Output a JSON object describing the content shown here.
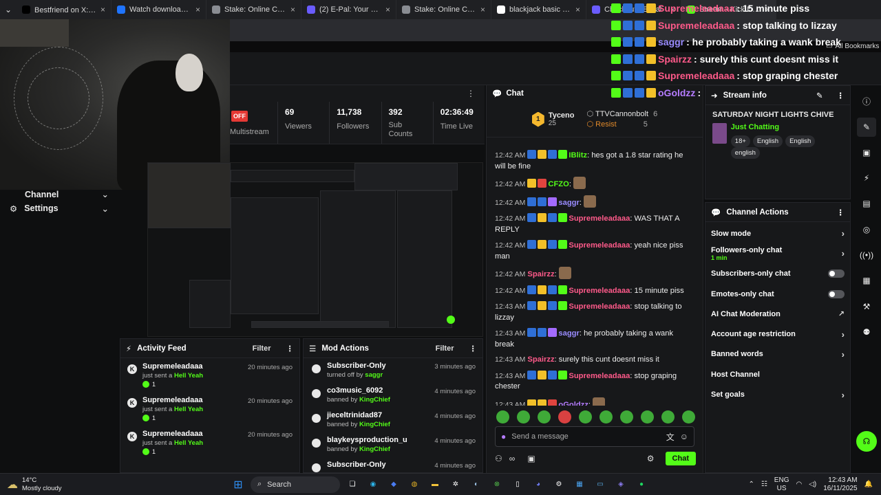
{
  "browser": {
    "tabs": [
      {
        "label": "Bestfriend on X: \"🎀Kick",
        "fav": "x-icon",
        "color": "#000000"
      },
      {
        "label": "Watch download (2) | Str",
        "fav": "globe-icon",
        "color": "#1f74ff"
      },
      {
        "label": "Stake: Online Casino &",
        "fav": "stake-icon",
        "color": "#8a8d93"
      },
      {
        "label": "(2) E-Pal: Your Kind Teamm",
        "fav": "epal-icon",
        "color": "#6a5cff"
      },
      {
        "label": "Stake: Online Casino & Sp",
        "fav": "stake-icon",
        "color": "#8a8d93"
      },
      {
        "label": "blackjack basic strategy -",
        "fav": "google-icon",
        "color": "#ffffff"
      },
      {
        "label": "Checkout - E-Pal",
        "fav": "epal-icon",
        "color": "#6a5cff"
      },
      {
        "label": "Stream - Kick Dashboard",
        "fav": "kick-icon",
        "color": "#53fc18"
      }
    ],
    "all_bookmarks": "All Bookmarks"
  },
  "overlay_chat": [
    {
      "user": "Supremeleadaaa",
      "text": ": 15 minute piss",
      "color": "#ff5a8a"
    },
    {
      "user": "Supremeleadaaa",
      "text": ": stop talking to lizzay",
      "color": "#ff5a8a"
    },
    {
      "user": "saggr",
      "text": ": he probably taking a wank break",
      "color": "#9a8cff"
    },
    {
      "user": "Spairzz",
      "text": ": surely this cunt doesnt miss it",
      "color": "#ff5a8a"
    },
    {
      "user": "Supremeleadaaa",
      "text": ": stop graping chester",
      "color": "#ff5a8a"
    },
    {
      "user": "oGoldzz",
      "text": ":",
      "color": "#b57cff"
    }
  ],
  "sidebar": {
    "channel": "Channel",
    "settings": "Settings"
  },
  "stream": {
    "off_label": "OFF",
    "multistream": "Multistream",
    "stats": [
      {
        "value": "69",
        "label": "Viewers"
      },
      {
        "value": "11,738",
        "label": "Followers"
      },
      {
        "value": "392",
        "label": "Sub Counts"
      },
      {
        "value": "02:36:49",
        "label": "Time Live"
      }
    ]
  },
  "activity_feed": {
    "title": "Activity Feed",
    "filter": "Filter",
    "items": [
      {
        "user": "Supremeleadaaa",
        "action": "just sent a",
        "item": "Hell Yeah",
        "count": "1",
        "time": "20 minutes ago"
      },
      {
        "user": "Supremeleadaaa",
        "action": "just sent a",
        "item": "Hell Yeah",
        "count": "1",
        "time": "20 minutes ago"
      },
      {
        "user": "Supremeleadaaa",
        "action": "just sent a",
        "item": "Hell Yeah",
        "count": "1",
        "time": "20 minutes ago"
      }
    ]
  },
  "mod_actions": {
    "title": "Mod Actions",
    "filter": "Filter",
    "items": [
      {
        "name": "Subscriber-Only",
        "action": "turned off by",
        "by": "saggr",
        "time": "3 minutes ago"
      },
      {
        "name": "co3music_6092",
        "action": "banned by",
        "by": "KingChief",
        "time": "4 minutes ago"
      },
      {
        "name": "jieceltrinidad87",
        "action": "banned by",
        "by": "KingChief",
        "time": "4 minutes ago"
      },
      {
        "name": "blaykeysproduction_u",
        "action": "banned by",
        "by": "KingChief",
        "time": "4 minutes ago"
      },
      {
        "name": "Subscriber-Only",
        "action": "",
        "by": "",
        "time": "4 minutes ago"
      }
    ]
  },
  "chat": {
    "title": "Chat",
    "pinned": {
      "rank": "1",
      "user1": "Tyceno",
      "user1_count": "25",
      "user2": "TTVCannonbolt",
      "user2_count": "6",
      "user3": "Resist",
      "user3_count": "5"
    },
    "messages": [
      {
        "time": "12:42 AM",
        "user": "IBlitz",
        "ucolor": "#53fc18",
        "text": "hes got a 1.8 star rating he will be fine",
        "badges": [
          "b-blue",
          "b-gold",
          "b-blue",
          "b-green"
        ]
      },
      {
        "time": "12:42 AM",
        "user": "CFZO",
        "ucolor": "#53fc18",
        "text": "",
        "badges": [
          "b-gold",
          "b-red"
        ],
        "emote": true
      },
      {
        "time": "12:42 AM",
        "user": "saggr",
        "ucolor": "#9a8cff",
        "text": "",
        "badges": [
          "b-blue",
          "b-blue",
          "b-purple"
        ],
        "emote": true
      },
      {
        "time": "12:42 AM",
        "user": "Supremeleadaaa",
        "ucolor": "#ff5a8a",
        "text": "WAS THAT A REPLY",
        "badges": [
          "b-blue",
          "b-gold",
          "b-blue",
          "b-green"
        ]
      },
      {
        "time": "12:42 AM",
        "user": "Supremeleadaaa",
        "ucolor": "#ff5a8a",
        "text": "yeah nice piss man",
        "badges": [
          "b-blue",
          "b-gold",
          "b-blue",
          "b-green"
        ]
      },
      {
        "time": "12:42 AM",
        "user": "Spairzz",
        "ucolor": "#ff5a8a",
        "text": "",
        "badges": [],
        "emote": true
      },
      {
        "time": "12:42 AM",
        "user": "Supremeleadaaa",
        "ucolor": "#ff5a8a",
        "text": "15 minute piss",
        "badges": [
          "b-blue",
          "b-gold",
          "b-blue",
          "b-green"
        ]
      },
      {
        "time": "12:43 AM",
        "user": "Supremeleadaaa",
        "ucolor": "#ff5a8a",
        "text": "stop talking to lizzay",
        "badges": [
          "b-blue",
          "b-gold",
          "b-blue",
          "b-green"
        ]
      },
      {
        "time": "12:43 AM",
        "user": "saggr",
        "ucolor": "#9a8cff",
        "text": "he probably taking a wank break",
        "badges": [
          "b-blue",
          "b-blue",
          "b-purple"
        ]
      },
      {
        "time": "12:43 AM",
        "user": "Spairzz",
        "ucolor": "#ff5a8a",
        "text": "surely this cunt doesnt miss it",
        "badges": []
      },
      {
        "time": "12:43 AM",
        "user": "Supremeleadaaa",
        "ucolor": "#ff5a8a",
        "text": "stop graping chester",
        "badges": [
          "b-blue",
          "b-gold",
          "b-blue",
          "b-green"
        ]
      },
      {
        "time": "12:43 AM",
        "user": "oGoldzz",
        "ucolor": "#b57cff",
        "text": "",
        "badges": [
          "b-gold",
          "b-gold",
          "b-red"
        ],
        "emote": true
      }
    ],
    "placeholder": "Send a message",
    "send_label": "Chat"
  },
  "stream_info": {
    "title": "Stream info",
    "stream_title": "SATURDAY NIGHT LIGHTS CHIVE",
    "category": "Just Chatting",
    "tags": [
      "18+",
      "English",
      "English",
      "english"
    ]
  },
  "channel_actions": {
    "title": "Channel Actions",
    "items": [
      {
        "label": "Slow mode",
        "kind": "chevron",
        "sub": ""
      },
      {
        "label": "Followers-only chat",
        "kind": "chevron",
        "sub": "1 min"
      },
      {
        "label": "Subscribers-only chat",
        "kind": "toggle",
        "sub": ""
      },
      {
        "label": "Emotes-only chat",
        "kind": "toggle",
        "sub": ""
      },
      {
        "label": "AI Chat Moderation",
        "kind": "external",
        "sub": ""
      },
      {
        "label": "Account age restriction",
        "kind": "chevron",
        "sub": ""
      },
      {
        "label": "Banned words",
        "kind": "chevron",
        "sub": ""
      },
      {
        "label": "Host Channel",
        "kind": "none",
        "sub": ""
      },
      {
        "label": "Set goals",
        "kind": "chevron",
        "sub": ""
      }
    ]
  },
  "taskbar": {
    "weather_temp": "14°C",
    "weather_desc": "Mostly cloudy",
    "search": "Search",
    "lang1": "ENG",
    "lang2": "US",
    "time": "12:43 AM",
    "date": "16/11/2025"
  },
  "colors": {
    "kick_green": "#53fc18",
    "accent_pink": "#ff5a8a"
  }
}
